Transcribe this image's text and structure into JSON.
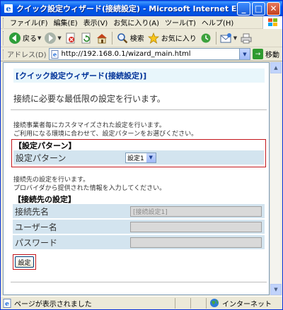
{
  "window": {
    "title": "クイック設定ウィザード(接続設定) - Microsoft Internet Explorer",
    "minimize_glyph": "_",
    "maximize_glyph": "□",
    "close_glyph": "✕"
  },
  "menubar": {
    "items": [
      {
        "label": "ファイル(F)"
      },
      {
        "label": "編集(E)"
      },
      {
        "label": "表示(V)"
      },
      {
        "label": "お気に入り(A)"
      },
      {
        "label": "ツール(T)"
      },
      {
        "label": "ヘルプ(H)"
      }
    ]
  },
  "toolbar": {
    "back_label": "戻る",
    "search_label": "検索",
    "favorites_label": "お気に入り"
  },
  "addressbar": {
    "label": "アドレス(D)",
    "url": "http://192.168.0.1/wizard_main.html",
    "go_label": "移動",
    "go_glyph": "→"
  },
  "page": {
    "title": "[クイック設定ウィザード(接続設定)]",
    "subtitle": "接続に必要な最低限の設定を行います。",
    "desc1_line1": "接続事業者毎にカスタマイズされた設定を行います。",
    "desc1_line2": "ご利用になる環境に合わせて、設定パターンをお選びください。",
    "pattern_section_title": "【設定パターン】",
    "pattern_label": "設定パターン",
    "pattern_value": "設定1",
    "desc2_line1": "接続先の設定を行います。",
    "desc2_line2": "プロバイダから提供された情報を入力してください。",
    "conn_section_title": "【接続先の設定】",
    "fields": [
      {
        "label": "接続先名",
        "value": "[接続設定1]"
      },
      {
        "label": "ユーザー名",
        "value": ""
      },
      {
        "label": "パスワード",
        "value": ""
      }
    ],
    "submit_label": "設定"
  },
  "statusbar": {
    "text": "ページが表示されました",
    "zone": "インターネット"
  },
  "colors": {
    "accent": "#0058ee",
    "highlight_box": "#c4161c",
    "row_bg": "#d3e4ef",
    "title_text": "#003399"
  }
}
